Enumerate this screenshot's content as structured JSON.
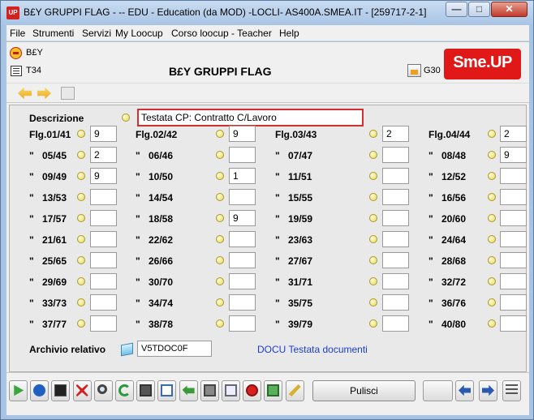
{
  "window": {
    "app_icon": "UP",
    "title": "B£Y GRUPPI FLAG -  -- EDU - Education (da MOD) -LOCLI- AS400A.SMEA.IT - [259717-2-1]",
    "min_icon": "minimize-icon",
    "max_icon": "maximize-icon",
    "close_icon": "close-icon"
  },
  "menu": [
    {
      "label": "File"
    },
    {
      "label": "Strumenti"
    },
    {
      "label": "Servizi"
    },
    {
      "label": "My Loocup"
    },
    {
      "label": "Corso loocup - Teacher"
    },
    {
      "label": "Help"
    }
  ],
  "header": {
    "code": "B£Y",
    "t34": "T34",
    "title": "B£Y GRUPPI FLAG",
    "g30": "G30",
    "logo": "Sme.UP"
  },
  "form": {
    "descrizione_label": "Descrizione",
    "descrizione_value": "Testata CP: Contratto C/Lavoro",
    "col_labels": [
      "Flg.01/41",
      "Flg.02/42",
      "Flg.03/43",
      "Flg.04/44"
    ],
    "rows": [
      {
        "labels": [
          "",
          "",
          "",
          ""
        ],
        "values": [
          "9",
          "9",
          "2",
          "2"
        ]
      },
      {
        "labels": [
          "05/45",
          "06/46",
          "07/47",
          "08/48"
        ],
        "values": [
          "2",
          "",
          "",
          "9"
        ]
      },
      {
        "labels": [
          "09/49",
          "10/50",
          "11/51",
          "12/52"
        ],
        "values": [
          "9",
          "1",
          "",
          ""
        ]
      },
      {
        "labels": [
          "13/53",
          "14/54",
          "15/55",
          "16/56"
        ],
        "values": [
          "",
          "",
          "",
          ""
        ]
      },
      {
        "labels": [
          "17/57",
          "18/58",
          "19/59",
          "20/60"
        ],
        "values": [
          "",
          "9",
          "",
          ""
        ]
      },
      {
        "labels": [
          "21/61",
          "22/62",
          "23/63",
          "24/64"
        ],
        "values": [
          "",
          "",
          "",
          ""
        ]
      },
      {
        "labels": [
          "25/65",
          "26/66",
          "27/67",
          "28/68"
        ],
        "values": [
          "",
          "",
          "",
          ""
        ]
      },
      {
        "labels": [
          "29/69",
          "30/70",
          "31/71",
          "32/72"
        ],
        "values": [
          "",
          "",
          "",
          ""
        ]
      },
      {
        "labels": [
          "33/73",
          "34/74",
          "35/75",
          "36/76"
        ],
        "values": [
          "",
          "",
          "",
          ""
        ]
      },
      {
        "labels": [
          "37/77",
          "38/78",
          "39/79",
          "40/80"
        ],
        "values": [
          "",
          "",
          "",
          ""
        ]
      }
    ],
    "quote_mark": "\"",
    "archivio_label": "Archivio relativo",
    "archivio_value": "V5TDOC0F",
    "archivio_desc": "DOCU Testata documenti"
  },
  "toolbar": {
    "pulisci_label": "Pulisci",
    "icons": [
      "play-icon",
      "help-icon",
      "terminal-icon",
      "cancel-icon",
      "search-icon",
      "refresh-icon",
      "save-icon",
      "copy-icon",
      "undo-icon",
      "print-icon",
      "pages-icon",
      "stop-icon",
      "export-icon",
      "wand-icon"
    ],
    "nav_icons": [
      "back-icon",
      "forward-icon",
      "list-icon"
    ]
  }
}
